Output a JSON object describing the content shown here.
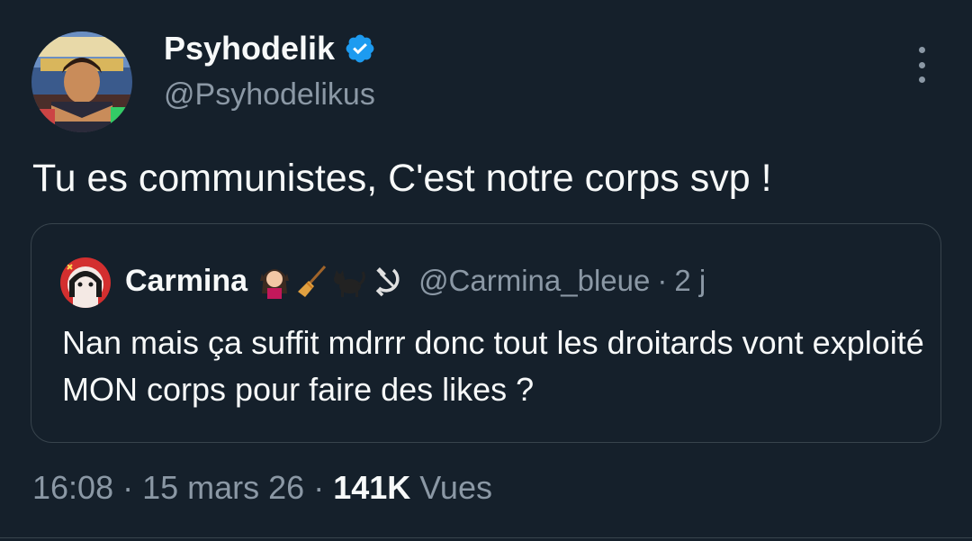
{
  "author": {
    "name": "Psyhodelik",
    "handle": "@Psyhodelikus",
    "verified": true
  },
  "tweet": {
    "text": "Tu es communistes, C'est notre corps svp !"
  },
  "quoted_tweet": {
    "name": "Carmina",
    "emojis": [
      "woman-emoji",
      "broom-emoji",
      "black-cat-emoji",
      "hammer-and-sickle-emoji"
    ],
    "handle": "@Carmina_bleue",
    "separator": "·",
    "time": "2 j",
    "text": "Nan mais ça suffit mdrrr donc tout les droitards vont exploité MON corps pour faire des likes ?"
  },
  "meta": {
    "time": "16:08",
    "date": "15 mars 26",
    "separator": "·",
    "views_count": "141K",
    "views_label": "Vues"
  },
  "colors": {
    "background": "#15202b",
    "text": "#f7f9f9",
    "secondary_text": "#8b98a5",
    "border": "#38444d",
    "verified_blue": "#1d9bf0"
  }
}
